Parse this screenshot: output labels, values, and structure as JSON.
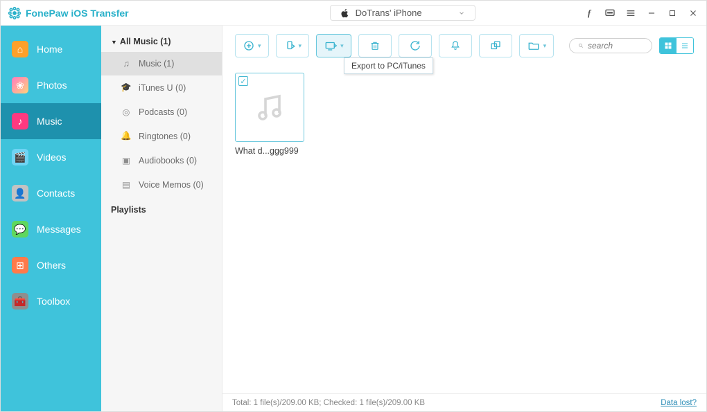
{
  "app": {
    "title": "FonePaw iOS Transfer"
  },
  "device": {
    "name": "DoTrans' iPhone"
  },
  "sidebar": {
    "items": [
      {
        "label": "Home"
      },
      {
        "label": "Photos"
      },
      {
        "label": "Music"
      },
      {
        "label": "Videos"
      },
      {
        "label": "Contacts"
      },
      {
        "label": "Messages"
      },
      {
        "label": "Others"
      },
      {
        "label": "Toolbox"
      }
    ]
  },
  "panel2": {
    "header": "All Music (1)",
    "items": [
      {
        "label": "Music (1)"
      },
      {
        "label": "iTunes U (0)"
      },
      {
        "label": "Podcasts (0)"
      },
      {
        "label": "Ringtones (0)"
      },
      {
        "label": "Audiobooks (0)"
      },
      {
        "label": "Voice Memos (0)"
      }
    ],
    "section": "Playlists"
  },
  "toolbar": {
    "tooltip": "Export to PC/iTunes",
    "search_placeholder": "search"
  },
  "content": {
    "items": [
      {
        "label": "What d...ggg999"
      }
    ]
  },
  "status": {
    "text": "Total: 1 file(s)/209.00 KB; Checked: 1 file(s)/209.00 KB",
    "right": "Data lost?"
  }
}
